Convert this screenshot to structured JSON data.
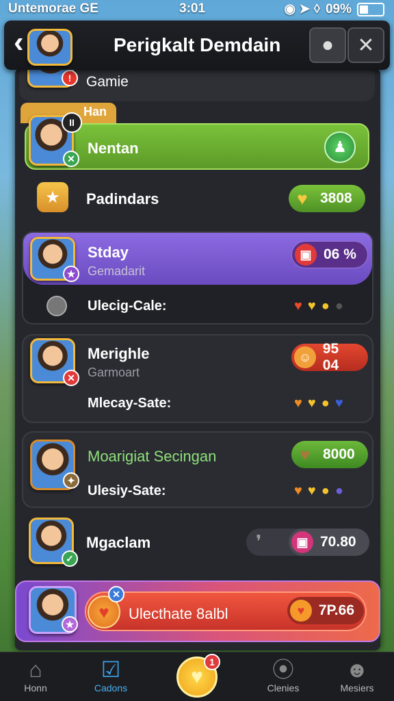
{
  "status": {
    "carrier": "Untemorae GE",
    "time": "3:01",
    "battery": "09%"
  },
  "header": {
    "title": "Perigkalt Demdain"
  },
  "top_row": {
    "label": "Gamie"
  },
  "tab_label": "Han",
  "rows": [
    {
      "label": "Nentan"
    },
    {
      "label": "Padindars",
      "value": "3808"
    },
    {
      "label": "Stday",
      "sub": "Gemadarit",
      "value": "06 %",
      "detail": "Ulecig-Cale:"
    },
    {
      "label": "Merighle",
      "sub": "Garmoart",
      "value": "95 04",
      "detail": "Mlecay-Sate:"
    },
    {
      "label": "Moarigiat Secingan",
      "value": "8000",
      "detail": "Ulesiy-Sate:"
    },
    {
      "label": "Mgaclam",
      "value": "70.80"
    },
    {
      "label": "Ulecthate 8albl",
      "value": "7P.66"
    }
  ],
  "nav": [
    {
      "label": "Honn",
      "icon": "home-icon"
    },
    {
      "label": "Cadons",
      "icon": "check-icon"
    },
    {
      "label": "",
      "icon": "heart-coin-icon",
      "badge": "1"
    },
    {
      "label": "Clenies",
      "icon": "search-icon"
    },
    {
      "label": "Mesiers",
      "icon": "profile-icon"
    }
  ]
}
